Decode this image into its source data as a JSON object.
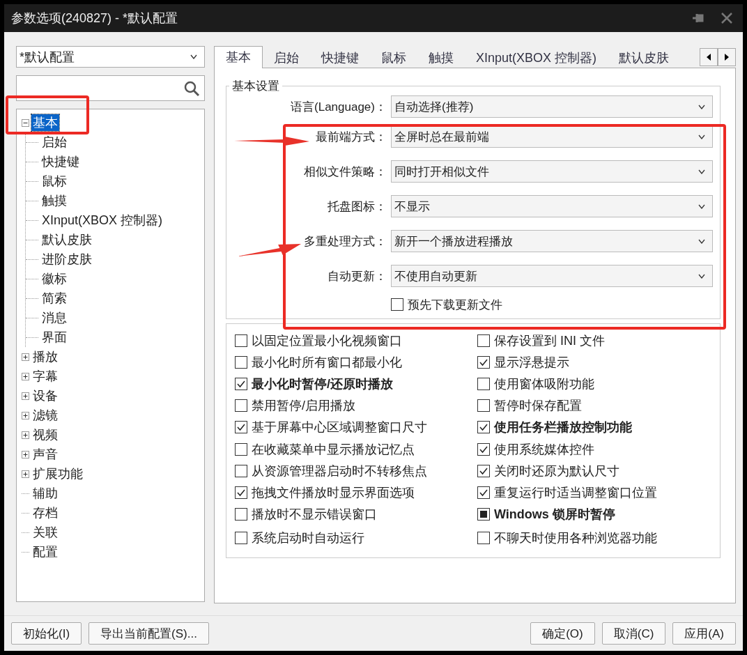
{
  "window": {
    "title": "参数选项(240827) - *默认配置"
  },
  "profile_select": {
    "value": "*默认配置"
  },
  "tree": [
    {
      "label": "基本",
      "kind": "group",
      "expanded": true,
      "selected": true,
      "children": [
        {
          "label": "启始",
          "kind": "leaf",
          "selected": false
        },
        {
          "label": "快捷键",
          "kind": "leaf",
          "selected": false
        },
        {
          "label": "鼠标",
          "kind": "leaf",
          "selected": false
        },
        {
          "label": "触摸",
          "kind": "leaf",
          "selected": false
        },
        {
          "label": "XInput(XBOX 控制器)",
          "kind": "leaf",
          "selected": false
        },
        {
          "label": "默认皮肤",
          "kind": "leaf",
          "selected": false
        },
        {
          "label": "进阶皮肤",
          "kind": "leaf",
          "selected": false
        },
        {
          "label": "徽标",
          "kind": "leaf",
          "selected": false
        },
        {
          "label": "简索",
          "kind": "leaf",
          "selected": false
        },
        {
          "label": "消息",
          "kind": "leaf",
          "selected": false
        },
        {
          "label": "界面",
          "kind": "leaf",
          "selected": false
        }
      ]
    },
    {
      "label": "播放",
      "kind": "group",
      "expanded": false,
      "selected": false
    },
    {
      "label": "字幕",
      "kind": "group",
      "expanded": false,
      "selected": false
    },
    {
      "label": "设备",
      "kind": "group",
      "expanded": false,
      "selected": false
    },
    {
      "label": "滤镜",
      "kind": "group",
      "expanded": false,
      "selected": false
    },
    {
      "label": "视频",
      "kind": "group",
      "expanded": false,
      "selected": false
    },
    {
      "label": "声音",
      "kind": "group",
      "expanded": false,
      "selected": false
    },
    {
      "label": "扩展功能",
      "kind": "group",
      "expanded": false,
      "selected": false
    },
    {
      "label": "辅助",
      "kind": "leaf",
      "selected": false
    },
    {
      "label": "存档",
      "kind": "leaf",
      "selected": false
    },
    {
      "label": "关联",
      "kind": "leaf",
      "selected": false
    },
    {
      "label": "配置",
      "kind": "leaf",
      "selected": false
    }
  ],
  "tabs": [
    {
      "label": "基本",
      "selected": true
    },
    {
      "label": "启始",
      "selected": false
    },
    {
      "label": "快捷键",
      "selected": false
    },
    {
      "label": "鼠标",
      "selected": false
    },
    {
      "label": "触摸",
      "selected": false
    },
    {
      "label": "XInput(XBOX 控制器)",
      "selected": false
    },
    {
      "label": "默认皮肤",
      "selected": false
    }
  ],
  "basic_settings": {
    "title": "基本设置",
    "rows": [
      {
        "kind": "dropdown",
        "label": "语言(Language)：",
        "value": "自动选择(推荐)"
      },
      {
        "kind": "dropdown",
        "label": "最前端方式：",
        "value": "全屏时总在最前端"
      },
      {
        "kind": "dropdown",
        "label": "相似文件策略：",
        "value": "同时打开相似文件"
      },
      {
        "kind": "dropdown",
        "label": "托盘图标：",
        "value": "不显示"
      },
      {
        "kind": "dropdown",
        "label": "多重处理方式：",
        "value": "新开一个播放进程播放"
      },
      {
        "kind": "dropdown",
        "label": "自动更新：",
        "value": "不使用自动更新"
      },
      {
        "kind": "checkbox",
        "label": "预先下载更新文件",
        "checked": false
      }
    ]
  },
  "options": {
    "left_column": [
      {
        "label": "以固定位置最小化视频窗口",
        "checked": false,
        "indeterminate": false,
        "bold": false
      },
      {
        "label": "最小化时所有窗口都最小化",
        "checked": false,
        "indeterminate": false,
        "bold": false
      },
      {
        "label": "最小化时暂停/还原时播放",
        "checked": true,
        "indeterminate": false,
        "bold": true
      },
      {
        "label": "禁用暂停/启用播放",
        "checked": false,
        "indeterminate": false,
        "bold": false
      },
      {
        "label": "基于屏幕中心区域调整窗口尺寸",
        "checked": true,
        "indeterminate": false,
        "bold": false
      },
      {
        "label": "在收藏菜单中显示播放记忆点",
        "checked": false,
        "indeterminate": false,
        "bold": false
      },
      {
        "label": "从资源管理器启动时不转移焦点",
        "checked": false,
        "indeterminate": false,
        "bold": false
      },
      {
        "label": "拖拽文件播放时显示界面选项",
        "checked": true,
        "indeterminate": false,
        "bold": false
      },
      {
        "label": "播放时不显示错误窗口",
        "checked": false,
        "indeterminate": false,
        "bold": false
      },
      {
        "label": "系统启动时自动运行",
        "checked": false,
        "indeterminate": false,
        "bold": false
      }
    ],
    "right_column": [
      {
        "label": "保存设置到 INI 文件",
        "checked": false,
        "indeterminate": false,
        "bold": false
      },
      {
        "label": "显示浮悬提示",
        "checked": true,
        "indeterminate": false,
        "bold": false
      },
      {
        "label": "使用窗体吸附功能",
        "checked": false,
        "indeterminate": false,
        "bold": false
      },
      {
        "label": "暂停时保存配置",
        "checked": false,
        "indeterminate": false,
        "bold": false
      },
      {
        "label": "使用任务栏播放控制功能",
        "checked": true,
        "indeterminate": false,
        "bold": true
      },
      {
        "label": "使用系统媒体控件",
        "checked": true,
        "indeterminate": false,
        "bold": false
      },
      {
        "label": "关闭时还原为默认尺寸",
        "checked": true,
        "indeterminate": false,
        "bold": false
      },
      {
        "label": "重复运行时适当调整窗口位置",
        "checked": true,
        "indeterminate": false,
        "bold": false
      },
      {
        "label": "Windows 锁屏时暂停",
        "checked": false,
        "indeterminate": true,
        "bold": true
      },
      {
        "label": "不聊天时使用各种浏览器功能",
        "checked": false,
        "indeterminate": false,
        "bold": false
      }
    ]
  },
  "footer": {
    "left_buttons": [
      "初始化(I)",
      "导出当前配置(S)..."
    ],
    "right_buttons": [
      "确定(O)",
      "取消(C)",
      "应用(A)"
    ]
  }
}
